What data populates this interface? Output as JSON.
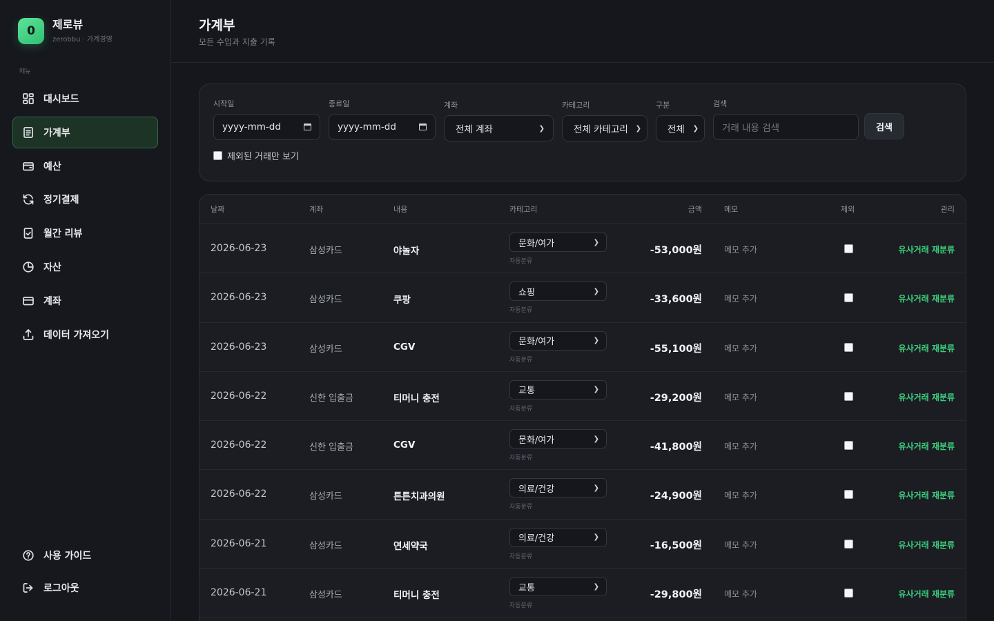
{
  "brand": {
    "logo_letter": "0",
    "name": "제로뷰",
    "subtitle": "zerobbu · 가계경영"
  },
  "sidebar": {
    "menu_label": "메뉴",
    "items": [
      {
        "label": "대시보드",
        "icon": "dashboard-icon",
        "active": false
      },
      {
        "label": "가계부",
        "icon": "ledger-icon",
        "active": true
      },
      {
        "label": "예산",
        "icon": "wallet-icon",
        "active": false
      },
      {
        "label": "정기결제",
        "icon": "refresh-icon",
        "active": false
      },
      {
        "label": "월간 리뷰",
        "icon": "review-icon",
        "active": false
      },
      {
        "label": "자산",
        "icon": "pie-chart-icon",
        "active": false
      },
      {
        "label": "계좌",
        "icon": "card-icon",
        "active": false
      },
      {
        "label": "데이터 가져오기",
        "icon": "upload-icon",
        "active": false
      }
    ],
    "bottom_items": [
      {
        "label": "사용 가이드",
        "icon": "help-icon"
      },
      {
        "label": "로그아웃",
        "icon": "logout-icon"
      }
    ]
  },
  "header": {
    "title": "가계부",
    "subtitle": "모든 수입과 지출 기록"
  },
  "filters": {
    "start_label": "시작일",
    "start_placeholder": "yyyy-mm-dd",
    "end_label": "종료일",
    "end_placeholder": "yyyy-mm-dd",
    "account_label": "계좌",
    "account_value": "전체 계좌",
    "category_label": "카테고리",
    "category_value": "전체 카테고리",
    "type_label": "구분",
    "type_value": "전체",
    "search_label": "검색",
    "search_placeholder": "거래 내용 검색",
    "search_button": "검색",
    "excluded_only_label": "제외된 거래만 보기"
  },
  "table": {
    "headers": {
      "date": "날짜",
      "account": "계좌",
      "desc": "내용",
      "category": "카테고리",
      "amount": "금액",
      "memo": "메모",
      "exclude": "제외",
      "manage": "관리"
    },
    "rows": [
      {
        "date": "2026-06-23",
        "account": "삼성카드",
        "desc": "야놀자",
        "category": "문화/여가",
        "auto": "자동분류",
        "amount": "-53,000원",
        "memo": "메모 추가",
        "action": "유사거래 재분류"
      },
      {
        "date": "2026-06-23",
        "account": "삼성카드",
        "desc": "쿠팡",
        "category": "쇼핑",
        "auto": "자동분류",
        "amount": "-33,600원",
        "memo": "메모 추가",
        "action": "유사거래 재분류"
      },
      {
        "date": "2026-06-23",
        "account": "삼성카드",
        "desc": "CGV",
        "category": "문화/여가",
        "auto": "자동분류",
        "amount": "-55,100원",
        "memo": "메모 추가",
        "action": "유사거래 재분류"
      },
      {
        "date": "2026-06-22",
        "account": "신한 입출금",
        "desc": "티머니 충전",
        "category": "교통",
        "auto": "자동분류",
        "amount": "-29,200원",
        "memo": "메모 추가",
        "action": "유사거래 재분류"
      },
      {
        "date": "2026-06-22",
        "account": "신한 입출금",
        "desc": "CGV",
        "category": "문화/여가",
        "auto": "자동분류",
        "amount": "-41,800원",
        "memo": "메모 추가",
        "action": "유사거래 재분류"
      },
      {
        "date": "2026-06-22",
        "account": "삼성카드",
        "desc": "튼튼치과의원",
        "category": "의료/건강",
        "auto": "자동분류",
        "amount": "-24,900원",
        "memo": "메모 추가",
        "action": "유사거래 재분류"
      },
      {
        "date": "2026-06-21",
        "account": "삼성카드",
        "desc": "연세약국",
        "category": "의료/건강",
        "auto": "자동분류",
        "amount": "-16,500원",
        "memo": "메모 추가",
        "action": "유사거래 재분류"
      },
      {
        "date": "2026-06-21",
        "account": "삼성카드",
        "desc": "티머니 충전",
        "category": "교통",
        "auto": "자동분류",
        "amount": "-29,800원",
        "memo": "메모 추가",
        "action": "유사거래 재분류"
      }
    ]
  },
  "colors": {
    "accent": "#3ccf7d",
    "active_nav_bg": "#1c3325",
    "background": "#15171c",
    "card": "#1b1d23"
  }
}
